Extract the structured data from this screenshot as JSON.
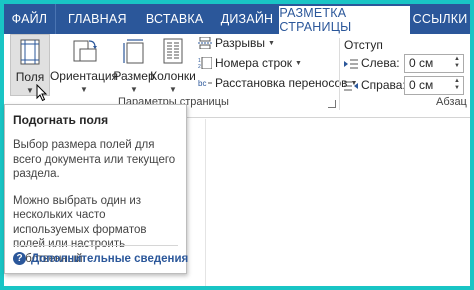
{
  "tabs": {
    "file": "ФАЙЛ",
    "home": "ГЛАВНАЯ",
    "insert": "ВСТАВКА",
    "design": "ДИЗАЙН",
    "layout": "РАЗМЕТКА СТРАНИЦЫ",
    "links": "ССЫЛКИ"
  },
  "ribbon": {
    "fields_label": "Поля",
    "orientation_label": "Ориентация",
    "size_label": "Размер",
    "columns_label": "Колонки",
    "breaks_label": "Разрывы",
    "line_numbers_label": "Номера строк",
    "hyphenation_label": "Расстановка переносов",
    "page_setup_group": "Параметры страницы",
    "indent_title": "Отступ",
    "indent_left_label": "Слева:",
    "indent_left_value": "0 см",
    "indent_right_label": "Справа:",
    "indent_right_value": "0 см",
    "paragraph_group_partial": "Абзац"
  },
  "tooltip": {
    "title": "Подогнать поля",
    "text1": "Выбор размера полей для всего документа или текущего раздела.",
    "text2": "Можно выбрать один из нескольких часто используемых форматов полей или настроить собственный.",
    "more": "Дополнительные сведения"
  },
  "colors": {
    "accent": "#2b579a",
    "frame": "#19c5c5"
  },
  "icons": [
    "margins-icon",
    "orientation-icon",
    "size-icon",
    "columns-icon",
    "breaks-icon",
    "line-numbers-icon",
    "hyphenation-icon",
    "indent-left-icon",
    "indent-right-icon",
    "help-icon",
    "mouse-cursor-icon"
  ]
}
